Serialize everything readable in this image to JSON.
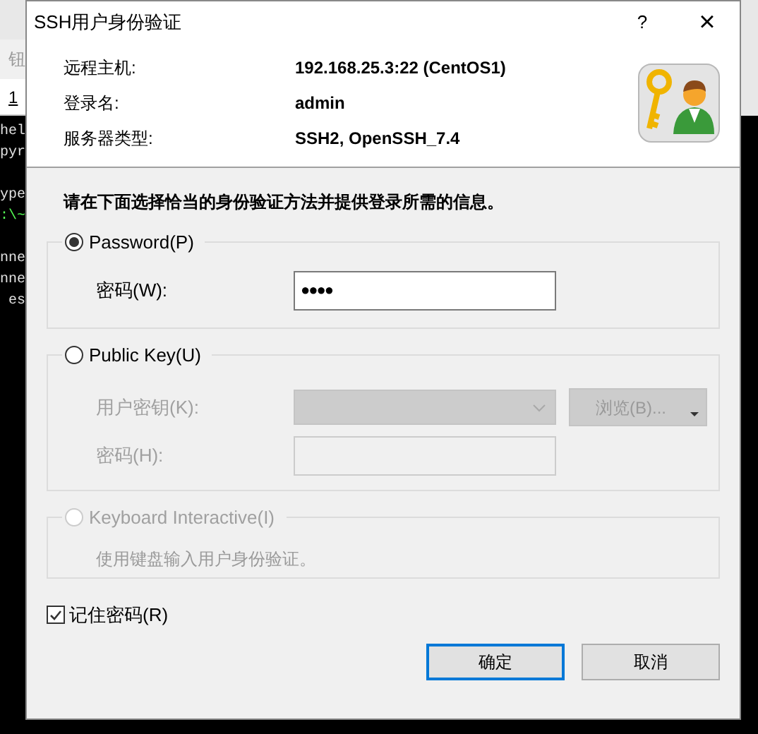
{
  "background": {
    "toolbar_text": "钮",
    "tab_label": "1",
    "terminal_blocks": [
      [
        "hel",
        "pyr"
      ],
      [
        "ype",
        ":\\~"
      ],
      [
        "nne",
        "nne",
        "es"
      ]
    ]
  },
  "window": {
    "title": "SSH用户身份验证",
    "help": "?",
    "close": "×"
  },
  "info": [
    {
      "label": "远程主机:",
      "value": "192.168.25.3:22 (CentOS1)"
    },
    {
      "label": "登录名:",
      "value": "admin"
    },
    {
      "label": "服务器类型:",
      "value": "SSH2, OpenSSH_7.4"
    }
  ],
  "instruction": "请在下面选择恰当的身份验证方法并提供登录所需的信息。",
  "methods": [
    {
      "kind": "password",
      "label": "Password(P)",
      "selected": true,
      "disabled": false,
      "fields": [
        {
          "label": "密码(W):",
          "value": "●●●●"
        }
      ]
    },
    {
      "kind": "publickey",
      "label": "Public Key(U)",
      "selected": false,
      "disabled": false,
      "fields": [
        {
          "label": "用户密钥(K):"
        },
        {
          "label": "密码(H):"
        }
      ],
      "browse": "浏览(B)..."
    },
    {
      "kind": "keyboard",
      "label": "Keyboard Interactive(I)",
      "selected": false,
      "disabled": true,
      "note": "使用键盘输入用户身份验证。"
    }
  ],
  "remember": {
    "label": "记住密码(R)",
    "checked": true
  },
  "buttons": [
    {
      "label": "确定",
      "default": true
    },
    {
      "label": "取消",
      "default": false
    }
  ]
}
